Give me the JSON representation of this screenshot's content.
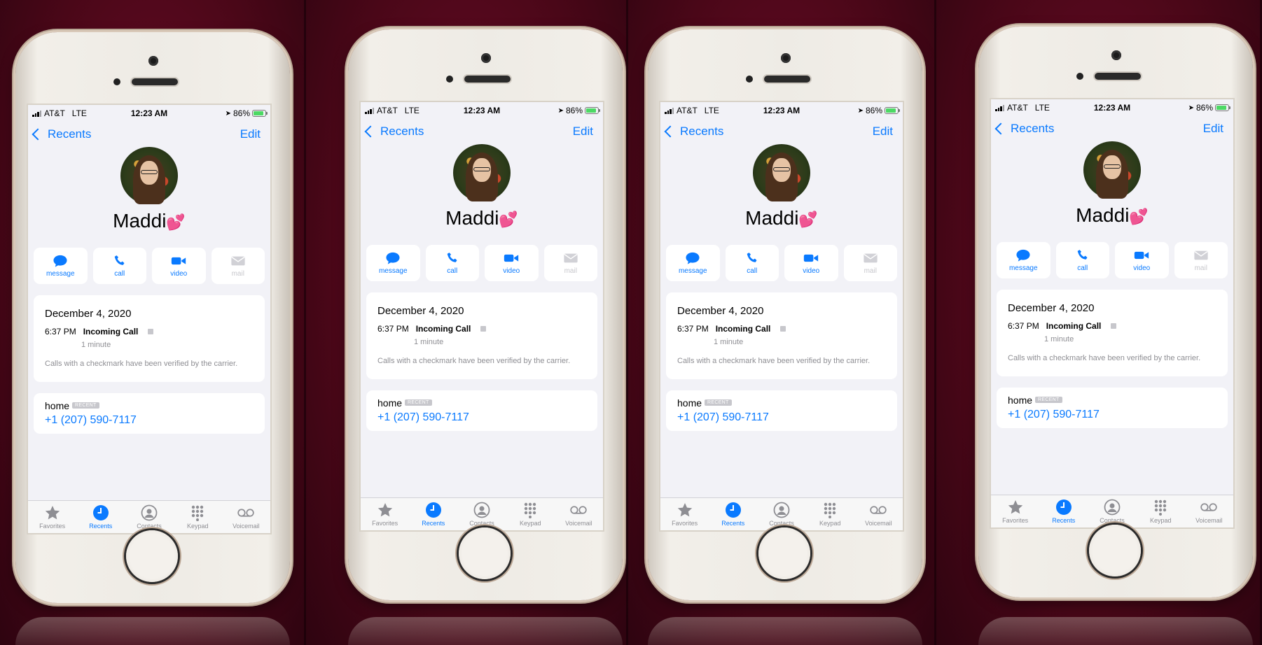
{
  "status": {
    "carrier": "AT&T",
    "network": "LTE",
    "time": "12:23 AM",
    "battery": "86%"
  },
  "nav": {
    "back_label": "Recents",
    "edit_label": "Edit"
  },
  "contact": {
    "name": "Maddi",
    "emoji": "💕"
  },
  "actions": [
    {
      "label": "message",
      "icon": "message-icon",
      "enabled": true
    },
    {
      "label": "call",
      "icon": "phone-icon",
      "enabled": true
    },
    {
      "label": "video",
      "icon": "video-icon",
      "enabled": true
    },
    {
      "label": "mail",
      "icon": "mail-icon",
      "enabled": false
    }
  ],
  "call_log": {
    "date": "December 4, 2020",
    "time": "6:37 PM",
    "type": "Incoming Call",
    "duration": "1 minute",
    "note": "Calls with a checkmark have been verified by the carrier."
  },
  "phone_number": {
    "label": "home",
    "badge": "RECENT",
    "number": "+1 (207) 590-7117"
  },
  "tabs": [
    {
      "label": "Favorites",
      "icon": "star-icon",
      "active": false
    },
    {
      "label": "Recents",
      "icon": "clock-icon",
      "active": true
    },
    {
      "label": "Contacts",
      "icon": "contacts-icon",
      "active": false
    },
    {
      "label": "Keypad",
      "icon": "keypad-icon",
      "active": false
    },
    {
      "label": "Voicemail",
      "icon": "voicemail-icon",
      "active": false
    }
  ],
  "colors": {
    "accent": "#0a7aff",
    "background": "#4a0718",
    "phone_body": "#eeebe5"
  }
}
